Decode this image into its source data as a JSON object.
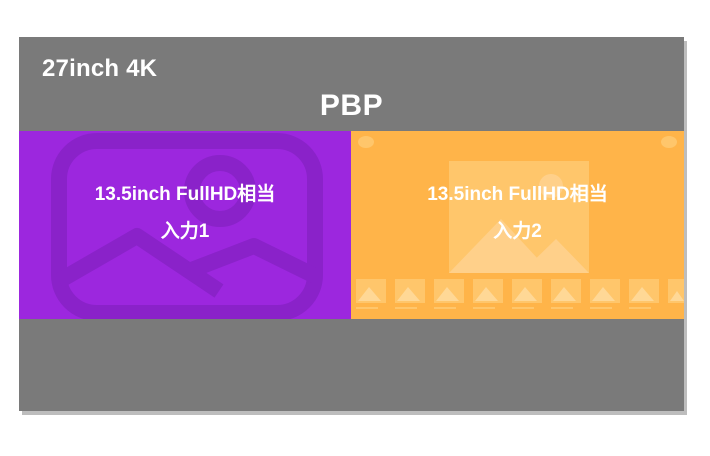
{
  "monitor": {
    "size_label": "27inch 4K",
    "mode_label": "PBP"
  },
  "panes": [
    {
      "name": "left",
      "size_label": "13.5inch FullHD相当",
      "input_label": "入力1",
      "color": "#9c27de"
    },
    {
      "name": "right",
      "size_label": "13.5inch FullHD相当",
      "input_label": "入力2",
      "color": "#ffb449"
    }
  ],
  "colors": {
    "monitor_bezel": "#7a7a7a",
    "text": "#ffffff"
  },
  "icons": [
    "image-placeholder-icon",
    "image-gallery-icon"
  ]
}
